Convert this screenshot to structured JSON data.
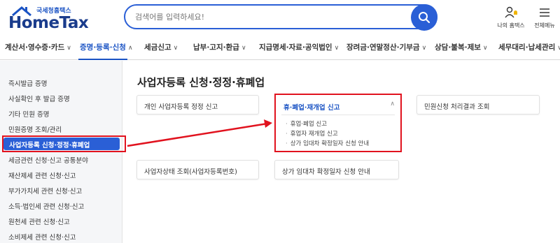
{
  "header": {
    "logo_top": "국세청홈택스",
    "logo_main": "HomeTax",
    "search_placeholder": "검색어를 입력하세요!",
    "my_hometax": "나의 홈택스",
    "full_menu": "전체메뉴"
  },
  "nav": {
    "items": [
      {
        "label": "계산서·영수증·카드"
      },
      {
        "label": "증명·등록·신청"
      },
      {
        "label": "세금신고"
      },
      {
        "label": "납부·고지·환급"
      },
      {
        "label": "지급명세·자료·공익법인"
      },
      {
        "label": "장려금·연말정산·기부금"
      },
      {
        "label": "상담·불복·제보"
      },
      {
        "label": "세무대리·납세관리"
      }
    ]
  },
  "sidebar": {
    "items": [
      {
        "label": "즉시발급 증명"
      },
      {
        "label": "사실확인 후 발급 증명"
      },
      {
        "label": "기타 민원 증명"
      },
      {
        "label": "민원증명 조회/관리"
      },
      {
        "label": "사업자등록 신청·정정·휴폐업"
      },
      {
        "label": "세금관련 신청·신고 공통분야"
      },
      {
        "label": "재산제세 관련 신청·신고"
      },
      {
        "label": "부가가치세 관련 신청·신고"
      },
      {
        "label": "소득·법인세 관련 신청·신고"
      },
      {
        "label": "원천세 관련 신청·신고"
      },
      {
        "label": "소비제세 관련 신청·신고"
      }
    ]
  },
  "main": {
    "title": "사업자등록 신청·정정·휴폐업",
    "cards": [
      {
        "label": "개인 사업자등록 정정 신고"
      },
      {
        "label": "휴·폐업·재개업 신고",
        "subitems": [
          "휴업·폐업 신고",
          "휴업자 재개업 신고",
          "상가 임대차 확정일자 신청 안내"
        ]
      },
      {
        "label": "민원신청 처리결과 조회"
      },
      {
        "label": "사업자상태 조회(사업자등록번호)"
      },
      {
        "label": "상가 임대차 확정일자 신청 안내"
      }
    ]
  },
  "colors": {
    "brand_blue": "#2a5fd6",
    "nav_active": "#1a53c4",
    "annotation_red": "#e1121e"
  }
}
